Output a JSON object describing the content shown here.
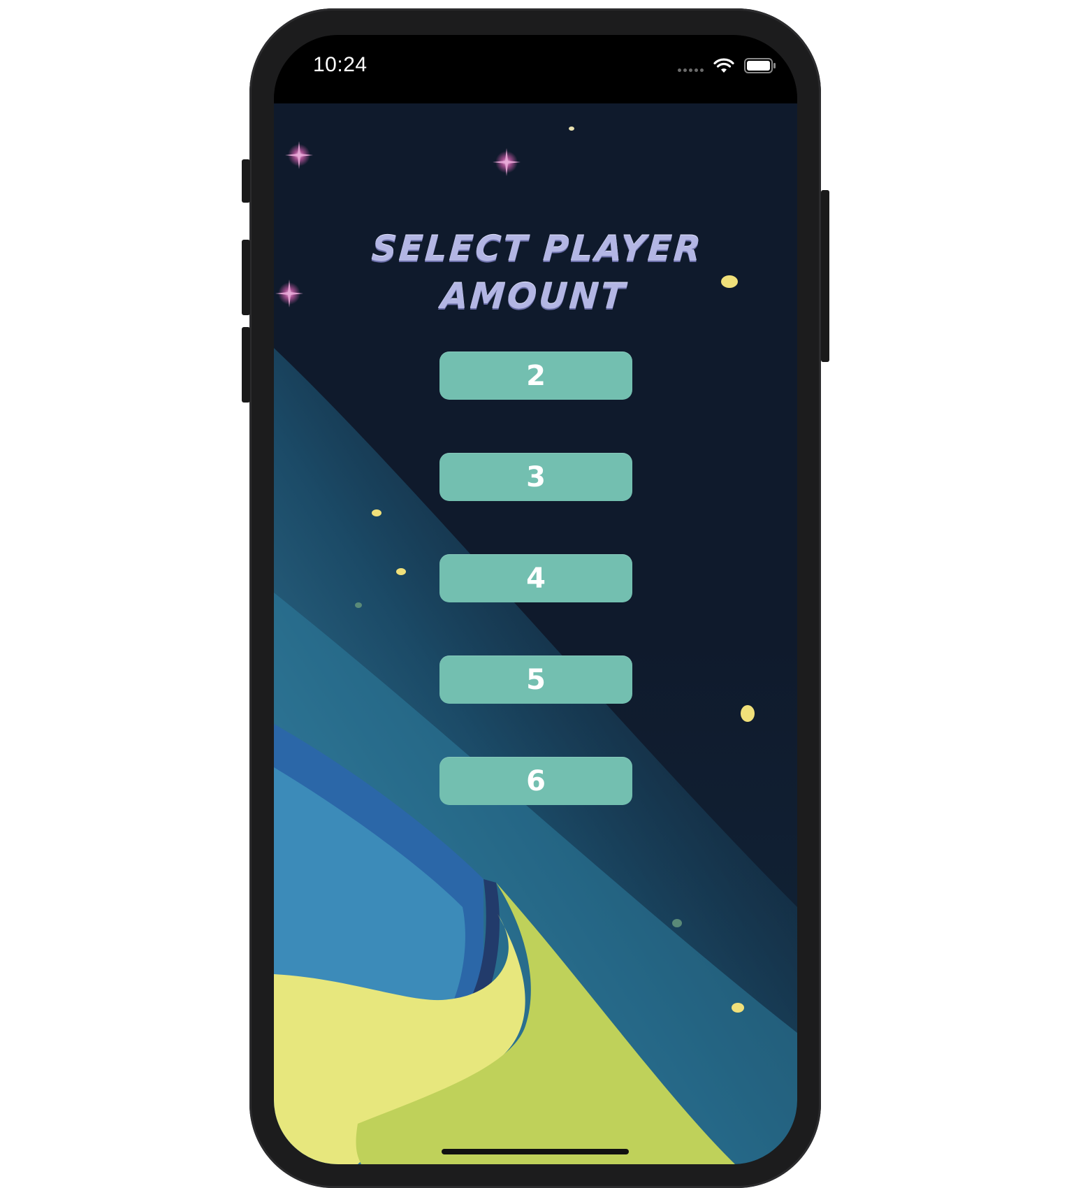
{
  "status_bar": {
    "time": "10:24"
  },
  "title": {
    "line1": "SELECT PLAYER",
    "line2": "AMOUNT"
  },
  "player_options": [
    {
      "label": "2"
    },
    {
      "label": "3"
    },
    {
      "label": "4"
    },
    {
      "label": "5"
    },
    {
      "label": "6"
    }
  ],
  "colors": {
    "button_fill": "#73bfb0",
    "button_text": "#ffffff",
    "title_text": "#b3b6e4",
    "sky": "#0f1a2b",
    "planet_blue": "#3c8bb9",
    "planet_yellow": "#e7e77d",
    "planet_green": "#bfd15a"
  },
  "icons": {
    "signal": "cellular-signal-icon",
    "wifi": "wifi-icon",
    "battery": "battery-icon"
  }
}
